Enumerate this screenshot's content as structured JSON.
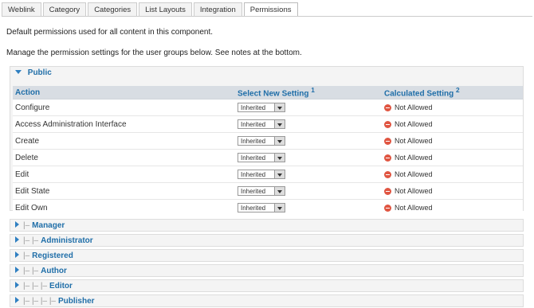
{
  "tabs": [
    "Weblink",
    "Category",
    "Categories",
    "List Layouts",
    "Integration",
    "Permissions"
  ],
  "active_tab": "Permissions",
  "intro": "Default permissions used for all content in this component.",
  "manage_note": "Manage the permission settings for the user groups below. See notes at the bottom.",
  "open_group": {
    "name": "Public"
  },
  "columns": {
    "action": "Action",
    "select": "Select New Setting",
    "select_note": "1",
    "calculated": "Calculated Setting",
    "calculated_note": "2"
  },
  "rows": [
    {
      "action": "Configure",
      "setting": "Inherited",
      "calculated": "Not Allowed"
    },
    {
      "action": "Access Administration Interface",
      "setting": "Inherited",
      "calculated": "Not Allowed"
    },
    {
      "action": "Create",
      "setting": "Inherited",
      "calculated": "Not Allowed"
    },
    {
      "action": "Delete",
      "setting": "Inherited",
      "calculated": "Not Allowed"
    },
    {
      "action": "Edit",
      "setting": "Inherited",
      "calculated": "Not Allowed"
    },
    {
      "action": "Edit State",
      "setting": "Inherited",
      "calculated": "Not Allowed"
    },
    {
      "action": "Edit Own",
      "setting": "Inherited",
      "calculated": "Not Allowed"
    }
  ],
  "groups": [
    {
      "prefix": "|–",
      "name": "Manager"
    },
    {
      "prefix": "|– |–",
      "name": "Administrator"
    },
    {
      "prefix": "|–",
      "name": "Registered"
    },
    {
      "prefix": "|– |–",
      "name": "Author"
    },
    {
      "prefix": "|– |– |–",
      "name": "Editor"
    },
    {
      "prefix": "|– |– |– |–",
      "name": "Publisher"
    }
  ],
  "colors": {
    "accent": "#1f6ea8",
    "deny": "#e05541",
    "header_bg": "#d8dde3"
  },
  "icons": {
    "expanded": "triangle-down-icon",
    "collapsed": "triangle-right-icon",
    "calculated": "not-allowed-icon"
  }
}
